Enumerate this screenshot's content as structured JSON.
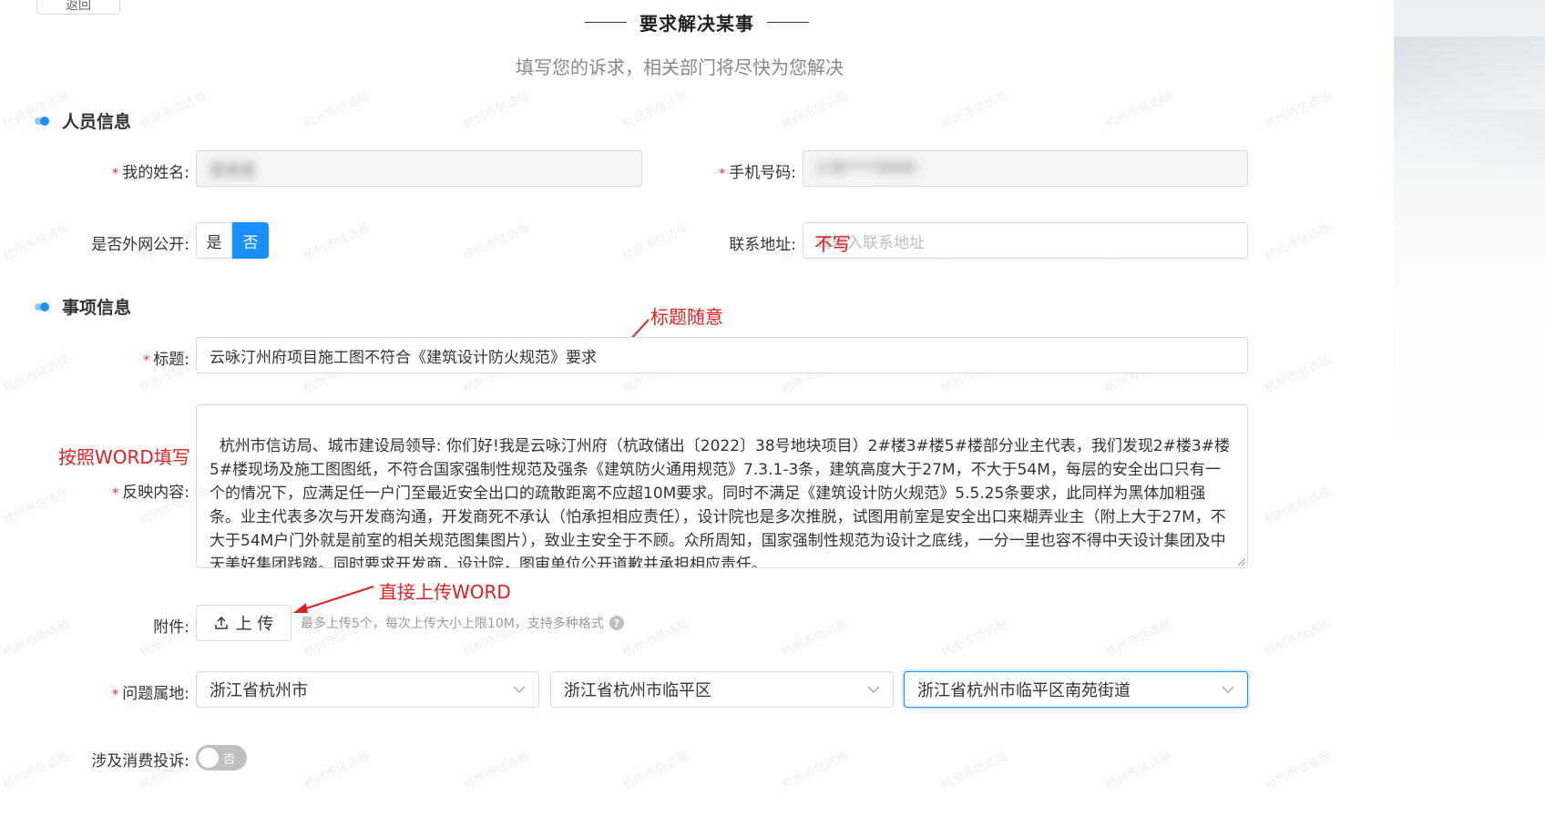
{
  "header": {
    "back_label": "返回",
    "page_title": "要求解决某事",
    "subtitle": "填写您的诉求，相关部门将尽快为您解决"
  },
  "watermark_text": "杭州市信访局",
  "personal": {
    "section_title": "人员信息",
    "name_label": "我的姓名:",
    "name_value": "某某某",
    "phone_label": "手机号码:",
    "phone_value": "138****0000",
    "public_label": "是否外网公开:",
    "public_options": [
      "是",
      "否"
    ],
    "public_selected": "否",
    "address_label": "联系地址:",
    "address_placeholder": "请输入联系地址"
  },
  "matter": {
    "section_title": "事项信息",
    "title_label": "标题:",
    "title_value": "云咏汀州府项目施工图不符合《建筑设计防火规范》要求",
    "content_label": "反映内容:",
    "content_value": "杭州市信访局、城市建设局领导: 你们好!我是云咏汀州府（杭政储出〔2022〕38号地块项目）2#楼3#楼5#楼部分业主代表，我们发现2#楼3#楼5#楼现场及施工图图纸，不符合国家强制性规范及强条《建筑防火通用规范》7.3.1-3条，建筑高度大于27M，不大于54M，每层的安全出口只有一个的情况下，应满足任一户门至最近安全出口的疏散距离不应超10M要求。同时不满足《建筑设计防火规范》5.5.25条要求，此同样为黑体加粗强条。业主代表多次与开发商沟通，开发商死不承认（怕承担相应责任），设计院也是多次推脱，试图用前室是安全出口来糊弄业主（附上大于27M，不大于54M户门外就是前室的相关规范图集图片），致业主安全于不顾。众所周知，国家强制性规范为设计之底线，一分一里也容不得中天设计集团及中天美好集团践踏。同时要求开发商，设计院，图审单位公开道歉并承担相应责任。\n同时附上图纸截图：  要求书面回复，如此问题不得到合理的解决，我们将继续向上信访，唯权！",
    "attachment_label": "附件:",
    "upload_label": "上 传",
    "upload_hint": "最多上传5个，每次上传大小上限10M，支持多种格式",
    "location_label": "问题属地:",
    "location_values": [
      "浙江省杭州市",
      "浙江省杭州市临平区",
      "浙江省杭州市临平区南苑街道"
    ],
    "consumer_label": "涉及消费投诉:",
    "consumer_switch_text": "否"
  },
  "annotations": {
    "address_note": "不写",
    "title_note": "标题随意",
    "content_note": "按照WORD填写",
    "upload_note": "直接上传WORD"
  },
  "colors": {
    "primary": "#1890ff",
    "required": "#f5222d",
    "annotation": "#e02020"
  }
}
